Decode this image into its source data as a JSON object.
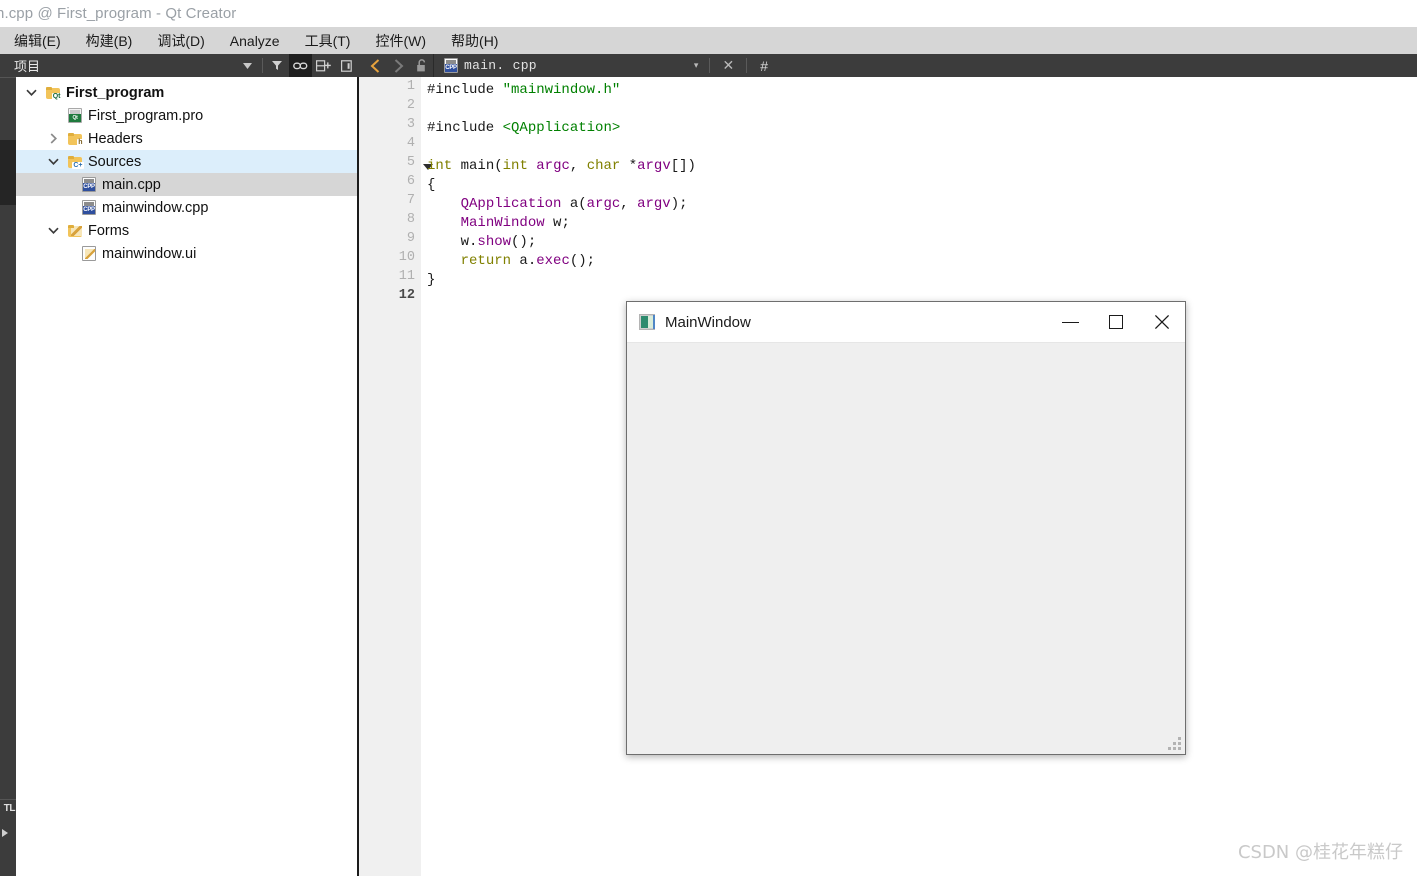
{
  "window": {
    "title": "n.cpp @ First_program - Qt Creator"
  },
  "menubar": {
    "items": [
      {
        "label": "编辑(E)",
        "accel": "E"
      },
      {
        "label": "构建(B)",
        "accel": "B"
      },
      {
        "label": "调试(D)",
        "accel": "D"
      },
      {
        "label": "Analyze",
        "accel": "A"
      },
      {
        "label": "工具(T)",
        "accel": "T"
      },
      {
        "label": "控件(W)",
        "accel": "W"
      },
      {
        "label": "帮助(H)",
        "accel": "H"
      }
    ]
  },
  "toolbar": {
    "sidebar_selector_label": "项目",
    "icons": [
      "chevron-down-icon",
      "filter-icon",
      "link-icon",
      "split-add-icon",
      "close-pane-icon",
      "back-icon",
      "forward-icon",
      "lock-icon"
    ]
  },
  "editor_tab": {
    "filename": "main. cpp",
    "icon": "cpp-file-icon",
    "dropdown": "▾",
    "close": "✕",
    "split": "#"
  },
  "tree": {
    "items": [
      {
        "label": "First_program",
        "icon": "qt-project-folder-icon",
        "expander": "down",
        "indent": 0,
        "bold": true,
        "selection": "none"
      },
      {
        "label": "First_program.pro",
        "icon": "pro-file-icon",
        "expander": "none",
        "indent": 1,
        "bold": false,
        "selection": "none"
      },
      {
        "label": "Headers",
        "icon": "headers-folder-icon",
        "expander": "right",
        "indent": 1,
        "bold": false,
        "selection": "none"
      },
      {
        "label": "Sources",
        "icon": "sources-folder-icon",
        "expander": "down",
        "indent": 1,
        "bold": false,
        "selection": "blue"
      },
      {
        "label": "main.cpp",
        "icon": "cpp-file-icon",
        "expander": "none",
        "indent": 2,
        "bold": false,
        "selection": "gray"
      },
      {
        "label": "mainwindow.cpp",
        "icon": "cpp-file-icon",
        "expander": "none",
        "indent": 2,
        "bold": false,
        "selection": "none"
      },
      {
        "label": "Forms",
        "icon": "forms-folder-icon",
        "expander": "down",
        "indent": 1,
        "bold": false,
        "selection": "none"
      },
      {
        "label": "mainwindow.ui",
        "icon": "ui-file-icon",
        "expander": "none",
        "indent": 2,
        "bold": false,
        "selection": "none"
      }
    ]
  },
  "code": {
    "line_numbers": [
      "1",
      "2",
      "3",
      "4",
      "5",
      "6",
      "7",
      "8",
      "9",
      "10",
      "11",
      "12"
    ],
    "current_line": 12,
    "fold_line": 5,
    "lines": [
      "#include \"mainwindow.h\"",
      "",
      "#include <QApplication>",
      "",
      "int main(int argc, char *argv[])",
      "{",
      "    QApplication a(argc, argv);",
      "    MainWindow w;",
      "    w.show();",
      "    return a.exec();",
      "}",
      ""
    ],
    "colors": {
      "string": "#008000",
      "keyword": "#808000",
      "type": "#800080",
      "plain": "#1a1a1a",
      "linenumber": "#b0b0b0"
    }
  },
  "mainwindow_popup": {
    "title": "MainWindow",
    "icon": "app-window-icon",
    "minimize": "minimize-icon",
    "maximize": "maximize-icon",
    "close": "close-icon",
    "resize_grip": "resize-grip-icon"
  },
  "watermark": {
    "text": "CSDN @桂花年糕仔"
  }
}
